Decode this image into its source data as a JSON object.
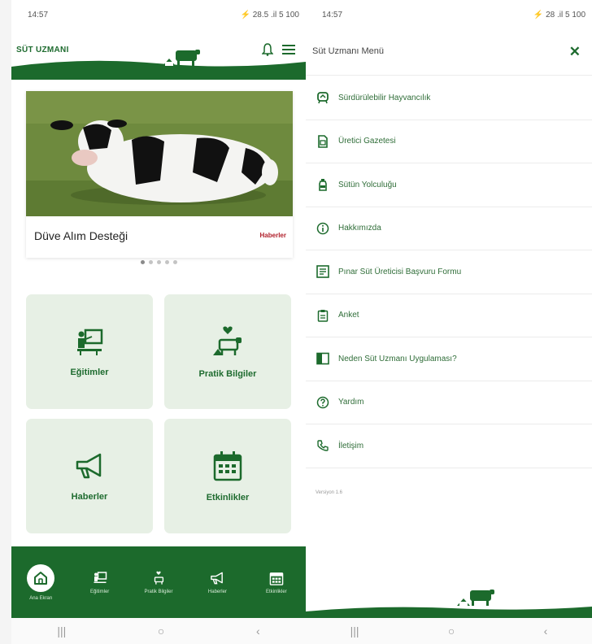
{
  "left_screen": {
    "status": {
      "time": "14:57",
      "indicators": "⚡ 28.5 .il 5 100"
    },
    "header": {
      "brand": "SÜT UZMANI",
      "icons": [
        "bell-icon",
        "hamburger-menu-icon"
      ]
    },
    "slider": {
      "title": "Düve Alım Desteği",
      "tag": "Haberler",
      "dots": 5,
      "active_dot": 0
    },
    "tiles": [
      {
        "label": "Eğitimler",
        "icon": "teacher-board-icon"
      },
      {
        "label": "Pratik Bilgiler",
        "icon": "cow-heart-icon"
      },
      {
        "label": "Haberler",
        "icon": "megaphone-icon"
      },
      {
        "label": "Etkinlikler",
        "icon": "calendar-icon"
      }
    ],
    "bottom_nav": [
      {
        "label": "Ana Ekran",
        "icon": "home-icon",
        "active": true
      },
      {
        "label": "Eğitimler",
        "icon": "teacher-board-icon"
      },
      {
        "label": "Pratik Bilgiler",
        "icon": "cow-heart-icon"
      },
      {
        "label": "Haberler",
        "icon": "megaphone-icon"
      },
      {
        "label": "Etkinlikler",
        "icon": "calendar-icon"
      }
    ]
  },
  "right_screen": {
    "status": {
      "time": "14:57",
      "indicators": "⚡ 28 .il 5 100"
    },
    "menu": {
      "title": "Süt Uzmanı Menü",
      "items": [
        {
          "label": "Sürdürülebilir Hayvancılık",
          "icon": "sustainability-icon"
        },
        {
          "label": "Üretici Gazetesi",
          "icon": "newspaper-icon"
        },
        {
          "label": "Sütün Yolculuğu",
          "icon": "milk-bottle-icon"
        },
        {
          "label": "Hakkımızda",
          "icon": "info-icon"
        },
        {
          "label": "Pınar Süt Üreticisi Başvuru Formu",
          "icon": "form-icon"
        },
        {
          "label": "Anket",
          "icon": "clipboard-icon"
        },
        {
          "label": "Neden Süt Uzmanı Uygulaması?",
          "icon": "book-icon"
        },
        {
          "label": "Yardım",
          "icon": "help-icon"
        },
        {
          "label": "İletişim",
          "icon": "phone-icon"
        }
      ],
      "version": "Versiyon 1.6"
    }
  },
  "system_nav": [
    "recents-icon",
    "home-circle-icon",
    "back-icon"
  ],
  "colors": {
    "primary": "#1c6a2c",
    "tile_bg": "#e7f0e5",
    "tag": "#b01f2a"
  }
}
